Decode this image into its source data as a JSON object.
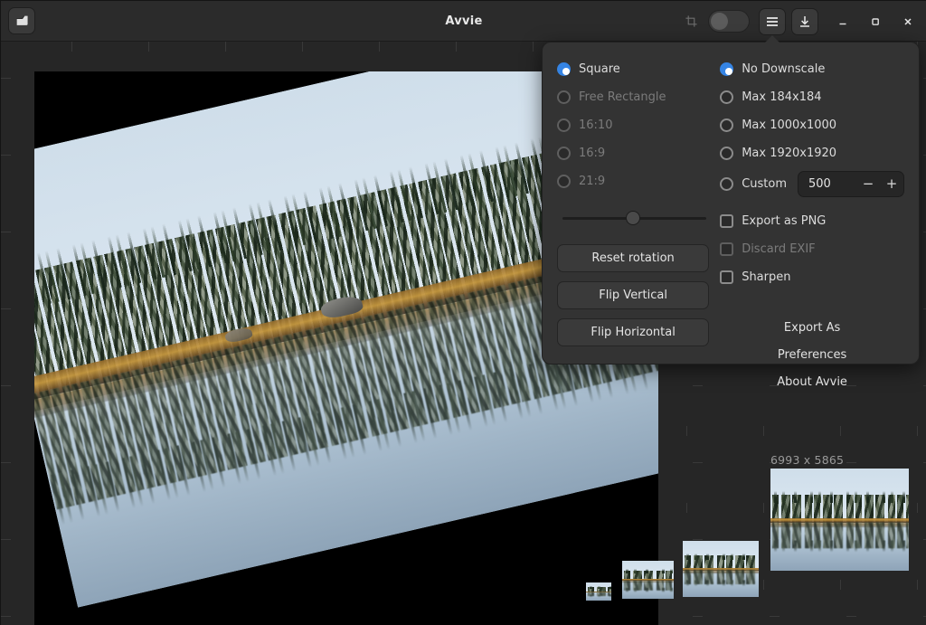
{
  "window": {
    "title": "Avvie",
    "open_icon": "open-file-icon",
    "crop_icon": "crop-icon",
    "menu_icon": "hamburger-menu-icon",
    "save_icon": "download-save-icon",
    "minimize_icon": "minimize-icon",
    "maximize_icon": "maximize-icon",
    "close_icon": "close-icon",
    "toggle_state": "off"
  },
  "menu": {
    "aspect_ratios": [
      {
        "label": "Square",
        "selected": true,
        "disabled": false
      },
      {
        "label": "Free Rectangle",
        "selected": false,
        "disabled": true
      },
      {
        "label": "16:10",
        "selected": false,
        "disabled": true
      },
      {
        "label": "16:9",
        "selected": false,
        "disabled": true
      },
      {
        "label": "21:9",
        "selected": false,
        "disabled": true
      }
    ],
    "downscale": [
      {
        "label": "No Downscale",
        "selected": true,
        "disabled": false
      },
      {
        "label": "Max 184x184",
        "selected": false,
        "disabled": false
      },
      {
        "label": "Max 1000x1000",
        "selected": false,
        "disabled": false
      },
      {
        "label": "Max 1920x1920",
        "selected": false,
        "disabled": false
      },
      {
        "label": "Custom",
        "selected": false,
        "disabled": false
      }
    ],
    "custom_value": "500",
    "spin_minus": "−",
    "spin_plus": "+",
    "checkboxes": [
      {
        "label": "Export as PNG",
        "checked": false,
        "disabled": false
      },
      {
        "label": "Discard EXIF",
        "checked": false,
        "disabled": true
      },
      {
        "label": "Sharpen",
        "checked": false,
        "disabled": false
      }
    ],
    "rotation_slider": {
      "value": 44
    },
    "buttons": [
      {
        "label": "Reset rotation"
      },
      {
        "label": "Flip Vertical"
      },
      {
        "label": "Flip Horizontal"
      }
    ],
    "links": [
      {
        "label": "Export As"
      },
      {
        "label": "Preferences"
      },
      {
        "label": "About Avvie"
      }
    ]
  },
  "preview": {
    "dimensions_label": "6993 x 5865",
    "thumbnails": [
      {
        "name": "thumb-xsmall"
      },
      {
        "name": "thumb-small"
      },
      {
        "name": "thumb-medium"
      },
      {
        "name": "thumb-large"
      }
    ]
  },
  "canvas": {
    "name": "crop-canvas",
    "rotation_deg": -13
  }
}
